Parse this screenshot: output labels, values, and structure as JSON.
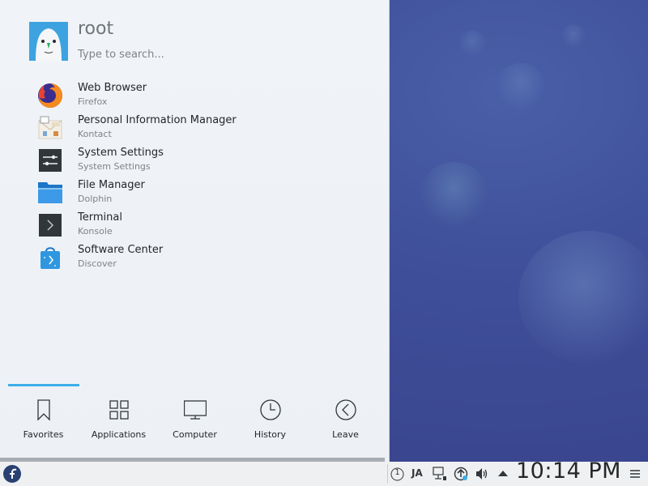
{
  "launcher": {
    "user": {
      "name": "root"
    },
    "search": {
      "placeholder": "Type to search..."
    },
    "favorites": [
      {
        "title": "Web Browser",
        "subtitle": "Firefox",
        "icon": "firefox-icon"
      },
      {
        "title": "Personal Information Manager",
        "subtitle": "Kontact",
        "icon": "kontact-icon"
      },
      {
        "title": "System Settings",
        "subtitle": "System Settings",
        "icon": "system-settings-icon"
      },
      {
        "title": "File Manager",
        "subtitle": "Dolphin",
        "icon": "folder-icon"
      },
      {
        "title": "Terminal",
        "subtitle": "Konsole",
        "icon": "terminal-icon"
      },
      {
        "title": "Software Center",
        "subtitle": "Discover",
        "icon": "discover-icon"
      }
    ],
    "tabs": [
      {
        "label": "Favorites",
        "icon": "bookmark-icon",
        "active": true
      },
      {
        "label": "Applications",
        "icon": "grid-icon",
        "active": false
      },
      {
        "label": "Computer",
        "icon": "monitor-icon",
        "active": false
      },
      {
        "label": "History",
        "icon": "clock-icon",
        "active": false
      },
      {
        "label": "Leave",
        "icon": "back-arrow-icon",
        "active": false
      }
    ],
    "accent_color": "#3daee9"
  },
  "panel": {
    "virtual_desktop": "1",
    "input_method": "JA",
    "clock": "10:14 PM",
    "tray_icons": [
      "desktop-pager-icon",
      "input-method-icon",
      "network-icon",
      "updates-icon",
      "volume-icon",
      "tray-expand-icon",
      "panel-menu-icon"
    ]
  }
}
